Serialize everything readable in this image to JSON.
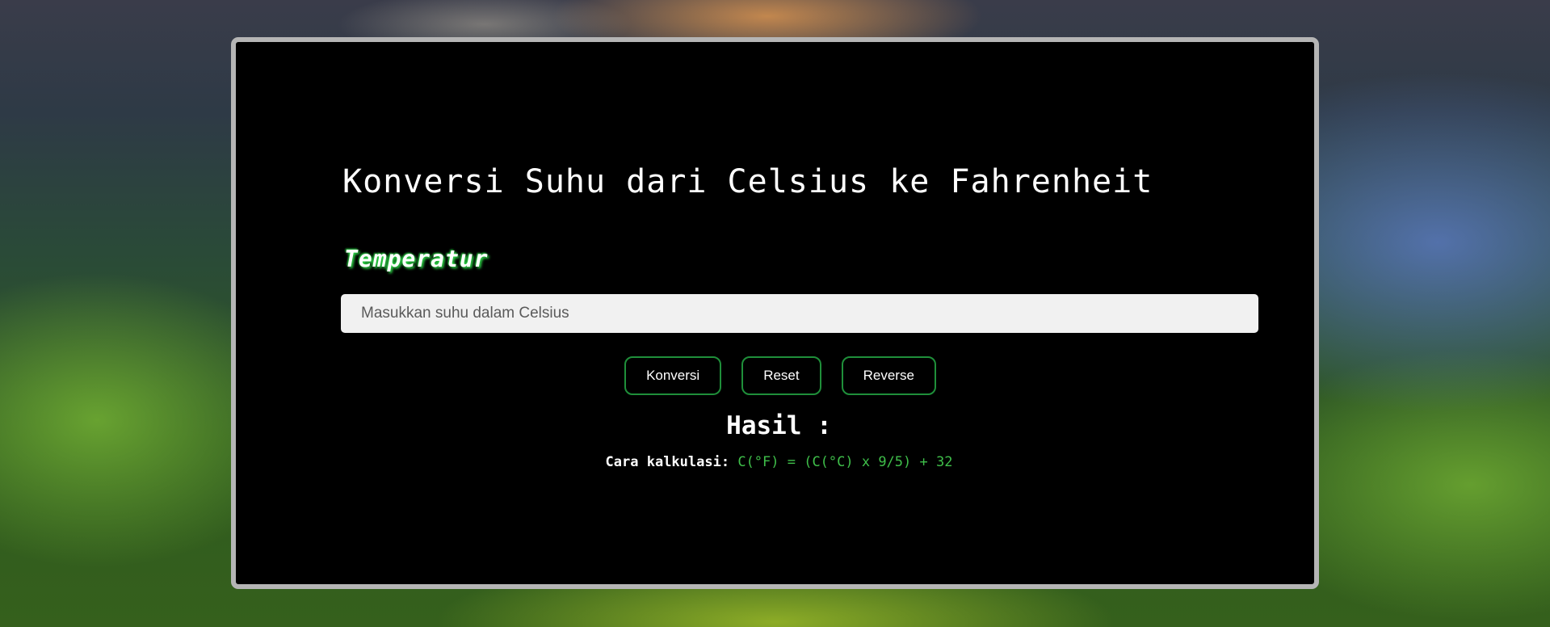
{
  "page": {
    "title": "Konversi Suhu dari Celsius ke Fahrenheit",
    "input_label": "Temperatur",
    "input": {
      "placeholder": "Masukkan suhu dalam Celsius",
      "value": ""
    },
    "buttons": {
      "convert": "Konversi",
      "reset": "Reset",
      "reverse": "Reverse"
    },
    "result_title": "Hasil :",
    "calculation": {
      "label": "Cara kalkulasi:",
      "formula": "C(°F) = (C(°C) x 9/5) + 32"
    }
  },
  "colors": {
    "panel_background": "#000000",
    "panel_border": "#b5b5b5",
    "button_border": "#1f8f3a",
    "formula_text": "#3fbf4a",
    "label_glow": "#2fe04a",
    "input_background": "#f1f1f1"
  }
}
